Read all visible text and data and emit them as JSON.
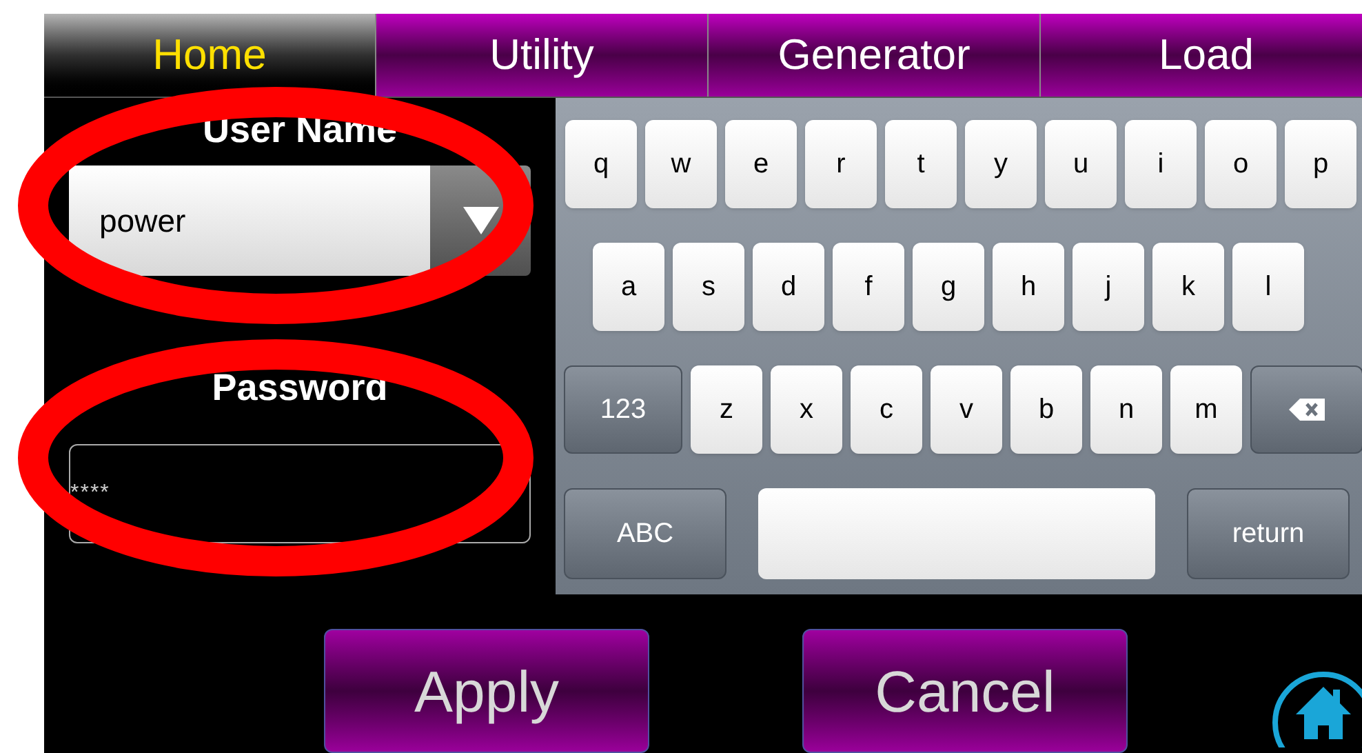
{
  "tabs": [
    {
      "label": "Home",
      "selected": true
    },
    {
      "label": "Utility",
      "selected": false
    },
    {
      "label": "Generator",
      "selected": false
    },
    {
      "label": "Load",
      "selected": false
    }
  ],
  "user_name": {
    "label": "User Name",
    "value": "power",
    "highlighted": true
  },
  "password": {
    "label": "Password",
    "value": "****",
    "highlighted": true
  },
  "keyboard": {
    "rows": [
      {
        "keys": [
          {
            "kind": "letter",
            "label": "q"
          },
          {
            "kind": "letter",
            "label": "w"
          },
          {
            "kind": "letter",
            "label": "e"
          },
          {
            "kind": "letter",
            "label": "r"
          },
          {
            "kind": "letter",
            "label": "t"
          },
          {
            "kind": "letter",
            "label": "y"
          },
          {
            "kind": "letter",
            "label": "u"
          },
          {
            "kind": "letter",
            "label": "i"
          },
          {
            "kind": "letter",
            "label": "o"
          },
          {
            "kind": "letter",
            "label": "p"
          }
        ]
      },
      {
        "keys": [
          {
            "kind": "letter",
            "label": "a"
          },
          {
            "kind": "letter",
            "label": "s"
          },
          {
            "kind": "letter",
            "label": "d"
          },
          {
            "kind": "letter",
            "label": "f"
          },
          {
            "kind": "letter",
            "label": "g"
          },
          {
            "kind": "letter",
            "label": "h"
          },
          {
            "kind": "letter",
            "label": "j"
          },
          {
            "kind": "letter",
            "label": "k"
          },
          {
            "kind": "letter",
            "label": "l"
          }
        ]
      },
      {
        "keys": [
          {
            "kind": "function",
            "label": "123"
          },
          {
            "kind": "letter",
            "label": "z"
          },
          {
            "kind": "letter",
            "label": "x"
          },
          {
            "kind": "letter",
            "label": "c"
          },
          {
            "kind": "letter",
            "label": "v"
          },
          {
            "kind": "letter",
            "label": "b"
          },
          {
            "kind": "letter",
            "label": "n"
          },
          {
            "kind": "letter",
            "label": "m"
          },
          {
            "kind": "backspace"
          }
        ]
      },
      {
        "keys": [
          {
            "kind": "wide",
            "label": "ABC"
          },
          {
            "kind": "space"
          },
          {
            "kind": "wide",
            "label": "return"
          }
        ]
      }
    ]
  },
  "buttons": [
    "Apply",
    "Cancel"
  ]
}
